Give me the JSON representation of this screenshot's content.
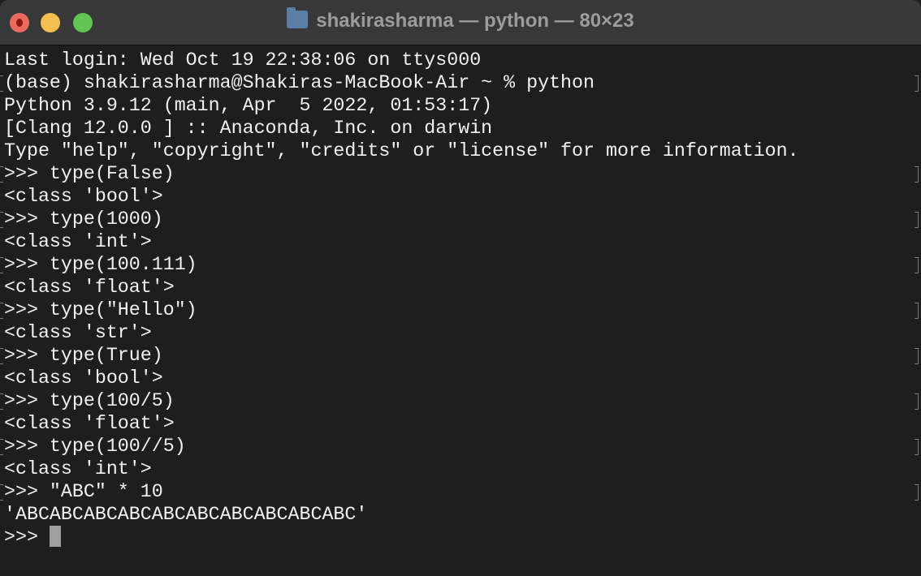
{
  "window": {
    "title": "shakirasharma — python — 80×23",
    "icon": "folder-home-icon"
  },
  "lines": [
    {
      "text": "Last login: Wed Oct 19 22:38:06 on ttys000",
      "marked": false
    },
    {
      "text": "(base) shakirasharma@Shakiras-MacBook-Air ~ % python",
      "marked": true
    },
    {
      "text": "Python 3.9.12 (main, Apr  5 2022, 01:53:17)",
      "marked": false
    },
    {
      "text": "[Clang 12.0.0 ] :: Anaconda, Inc. on darwin",
      "marked": false
    },
    {
      "text": "Type \"help\", \"copyright\", \"credits\" or \"license\" for more information.",
      "marked": false
    },
    {
      "text": ">>> type(False)",
      "marked": true
    },
    {
      "text": "<class 'bool'>",
      "marked": false
    },
    {
      "text": ">>> type(1000)",
      "marked": true
    },
    {
      "text": "<class 'int'>",
      "marked": false
    },
    {
      "text": ">>> type(100.111)",
      "marked": true
    },
    {
      "text": "<class 'float'>",
      "marked": false
    },
    {
      "text": ">>> type(\"Hello\")",
      "marked": true
    },
    {
      "text": "<class 'str'>",
      "marked": false
    },
    {
      "text": ">>> type(True)",
      "marked": true
    },
    {
      "text": "<class 'bool'>",
      "marked": false
    },
    {
      "text": ">>> type(100/5)",
      "marked": true
    },
    {
      "text": "<class 'float'>",
      "marked": false
    },
    {
      "text": ">>> type(100//5)",
      "marked": true
    },
    {
      "text": "<class 'int'>",
      "marked": false
    },
    {
      "text": ">>> \"ABC\" * 10",
      "marked": true
    },
    {
      "text": "'ABCABCABCABCABCABCABCABCABCABC'",
      "marked": false
    }
  ],
  "prompt": ">>> "
}
